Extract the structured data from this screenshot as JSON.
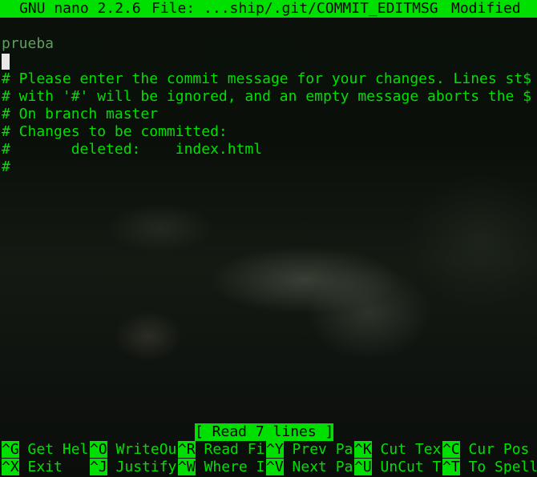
{
  "titlebar": {
    "app": "GNU nano 2.2.6",
    "file": "File: ...ship/.git/COMMIT_EDITMSG",
    "state": "Modified"
  },
  "editor": {
    "lines": [
      "prueba",
      "",
      "# Please enter the commit message for your changes. Lines st$",
      "# with '#' will be ignored, and an empty message aborts the $",
      "# On branch master",
      "# Changes to be committed:",
      "#       deleted:    index.html",
      "#"
    ]
  },
  "status": {
    "message": "[ Read 7 lines ]"
  },
  "shortcuts": {
    "row1": [
      {
        "key": "^G",
        "label": "Get Hel"
      },
      {
        "key": "^O",
        "label": "WriteOu"
      },
      {
        "key": "^R",
        "label": "Read Fi"
      },
      {
        "key": "^Y",
        "label": "Prev Pa"
      },
      {
        "key": "^K",
        "label": "Cut Tex"
      },
      {
        "key": "^C",
        "label": "Cur Pos"
      }
    ],
    "row2": [
      {
        "key": "^X",
        "label": "Exit"
      },
      {
        "key": "^J",
        "label": "Justify"
      },
      {
        "key": "^W",
        "label": "Where I"
      },
      {
        "key": "^V",
        "label": "Next Pa"
      },
      {
        "key": "^U",
        "label": "UnCut T"
      },
      {
        "key": "^T",
        "label": "To Spell"
      }
    ]
  },
  "colors": {
    "terminal_green": "#00e000",
    "background": "#050805",
    "cursor": "#e8e8e8"
  }
}
